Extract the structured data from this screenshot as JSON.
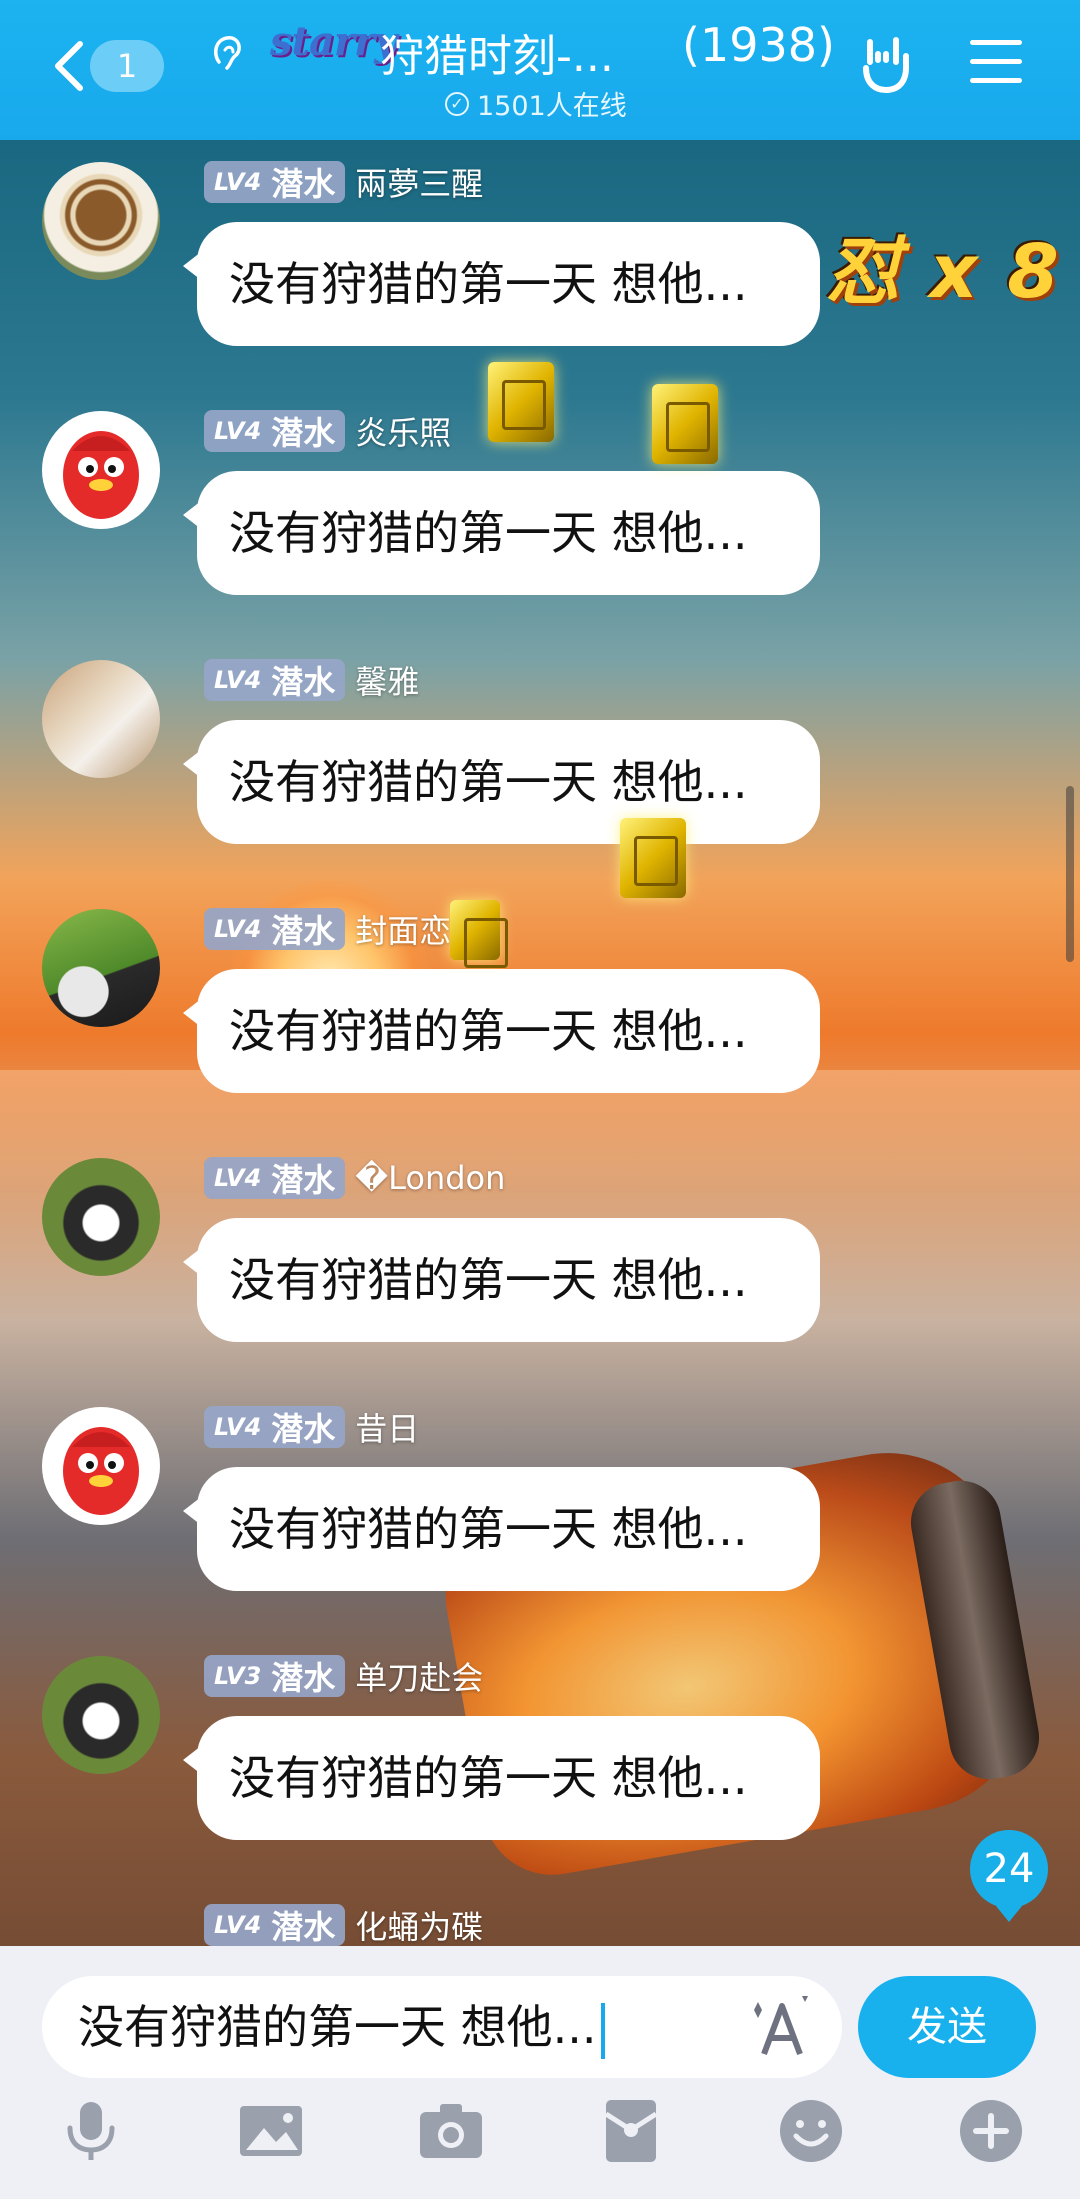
{
  "header": {
    "back_count": "1",
    "logo_text": "starry",
    "title": "狩猎时刻-...",
    "member_count": "(1938)",
    "online_text": "1501人在线",
    "online_icon": "check-circle-icon"
  },
  "messages": [
    {
      "level": "LV4",
      "rank": "潜水",
      "name": "兩夢三醒",
      "text": "没有狩猎的第一天 想他...",
      "avatar": "coffee"
    },
    {
      "level": "LV4",
      "rank": "潜水",
      "name": "炎乐照",
      "text": "没有狩猎的第一天 想他...",
      "avatar": "qq-penguin"
    },
    {
      "level": "LV4",
      "rank": "潜水",
      "name": "馨雅",
      "text": "没有狩猎的第一天 想他...",
      "avatar": "paper"
    },
    {
      "level": "LV4",
      "rank": "潜水",
      "name": "封面恋",
      "text": "没有狩猎的第一天 想他...",
      "avatar": "penguin"
    },
    {
      "level": "LV4",
      "rank": "潜水",
      "name": "�London",
      "text": "没有狩猎的第一天 想他...",
      "avatar": "husky"
    },
    {
      "level": "LV4",
      "rank": "潜水",
      "name": "昔日",
      "text": "没有狩猎的第一天 想他...",
      "avatar": "qq-penguin"
    },
    {
      "level": "LV3",
      "rank": "潜水",
      "name": "单刀赴会",
      "text": "没有狩猎的第一天 想他...",
      "avatar": "husky"
    },
    {
      "level": "LV4",
      "rank": "潜水",
      "name": "化蛹为碟",
      "text": "",
      "avatar": "partial"
    }
  ],
  "combo_text": "怼 x 8",
  "new_message_count": "24",
  "composer": {
    "input_value": "没有狩猎的第一天 想他...",
    "send_label": "发送"
  },
  "toolbar_icons": [
    "microphone-icon",
    "image-icon",
    "camera-icon",
    "red-packet-icon",
    "emoji-icon",
    "plus-icon"
  ],
  "colors": {
    "accent": "#18a9ec",
    "badge": "#96a5c8",
    "bubble": "#ffffff"
  }
}
